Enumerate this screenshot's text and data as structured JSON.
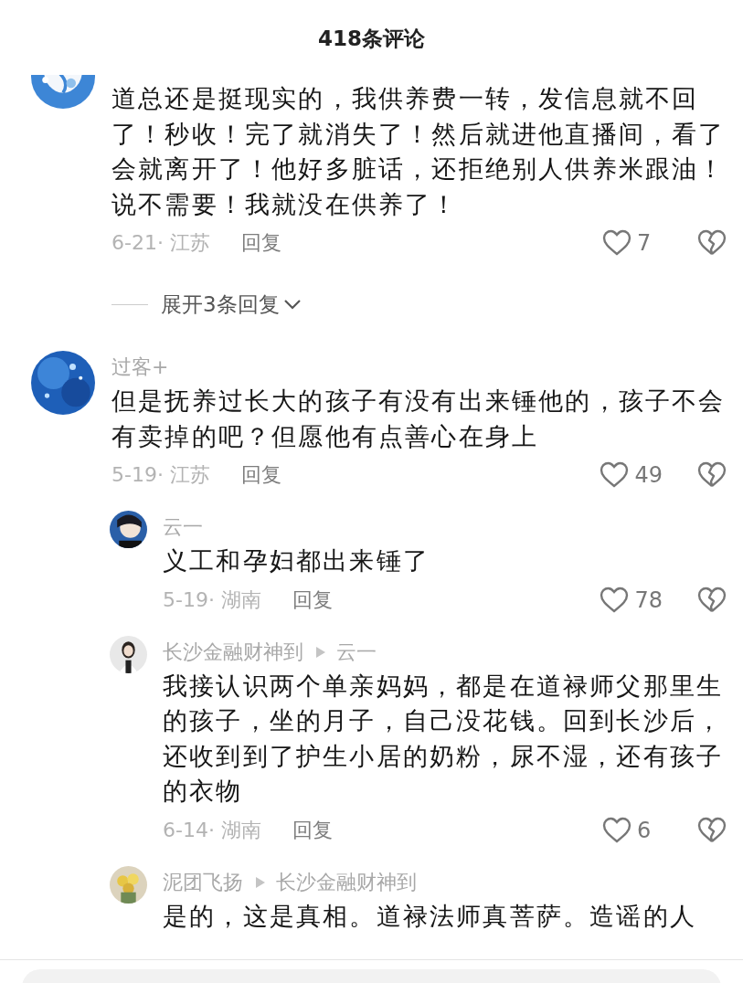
{
  "header": {
    "title": "418条评论"
  },
  "items": [
    {
      "kind": "comment",
      "text": "道总还是挺现实的，我供养费一转，发信息就不回了！秒收！完了就消失了！然后就进他直播间，看了会就离开了！他好多脏话，还拒绝别人供养米跟油！说不需要！我就没在供养了！",
      "meta": "6-21· 江苏",
      "reply": "回复",
      "likes": "7"
    },
    {
      "kind": "expand",
      "label": "展开3条回复"
    },
    {
      "kind": "comment",
      "author": "过客+",
      "text": "但是抚养过长大的孩子有没有出来锤他的，孩子不会有卖掉的吧？但愿他有点善心在身上",
      "meta": "5-19· 江苏",
      "reply": "回复",
      "likes": "49"
    },
    {
      "kind": "reply",
      "author": "云一",
      "text": "义工和孕妇都出来锤了",
      "meta": "5-19· 湖南",
      "reply": "回复",
      "likes": "78"
    },
    {
      "kind": "reply",
      "author": "长沙金融财神到",
      "reply_to": "云一",
      "text": "我接认识两个单亲妈妈，都是在道禄师父那里生的孩子，坐的月子，自己没花钱。回到长沙后，还收到到了护生小居的奶粉，尿不湿，还有孩子的衣物",
      "meta": "6-14· 湖南",
      "reply": "回复",
      "likes": "6"
    },
    {
      "kind": "reply",
      "author": "泥团飞扬",
      "reply_to": "长沙金融财神到",
      "text": "是的，这是真相。道禄法师真菩萨。造谣的人"
    }
  ]
}
